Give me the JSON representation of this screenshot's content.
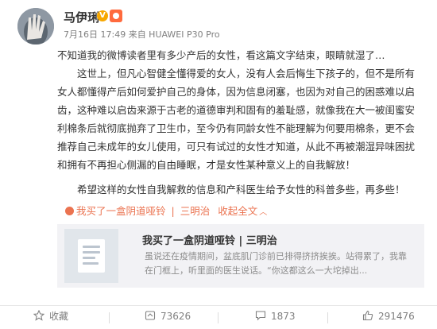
{
  "author": {
    "name": "马伊琍",
    "verified_badge": "V",
    "meta": "7月16日 17:49 来自 HUAWEI P30 Pro"
  },
  "post": {
    "paragraph1": "不知道我的微博读者里有多少产后的女性，看这篇文字结束，眼睛就湿了…",
    "paragraph2": "这世上，但凡心智健全懂得爱的女人，没有人会后悔生下孩子的，但不是所有女人都懂得产后如何爱护自己的身体，因为信息闭塞，也因为对自己的困惑难以启齿，这种难以启齿来源于古老的道德审判和固有的羞耻感，就像我在大一被闺蜜安利棉条后就彻底抛弃了卫生巾，至今仍有同龄女性不能理解为何要用棉条，更不会推荐自己未成年的女儿使用，可只有试过的女性才知道，从此不再被潮湿异味困扰和拥有不再担心侧漏的自由睡眠，才是女性某种意义上的自我解放！",
    "paragraph3": "希望这样的女性自我解救的信息和产科医生给予女性的科普多些，再多些！"
  },
  "tags": {
    "article_link": "我买了一盒阴道哑铃",
    "divider1": "|",
    "mention": "三明治",
    "collapse": "收起全文",
    "collapse_arrow": "︿"
  },
  "card": {
    "title": "我买了一盒阴道哑铃 | 三明治",
    "description": "虽说还在疫情期间，盆底肌门诊前已排得挤挤挨挨。站得累了，我靠在门框上，听里面的医生说话。“你这都这么一大坨掉出..."
  },
  "actions": {
    "favorite": "收藏",
    "repost": "73626",
    "comment": "1873",
    "like": "291476"
  },
  "colors": {
    "link": "#eb7350",
    "meta": "#808080",
    "card_bg": "#f2f2f5",
    "text": "#333333"
  }
}
